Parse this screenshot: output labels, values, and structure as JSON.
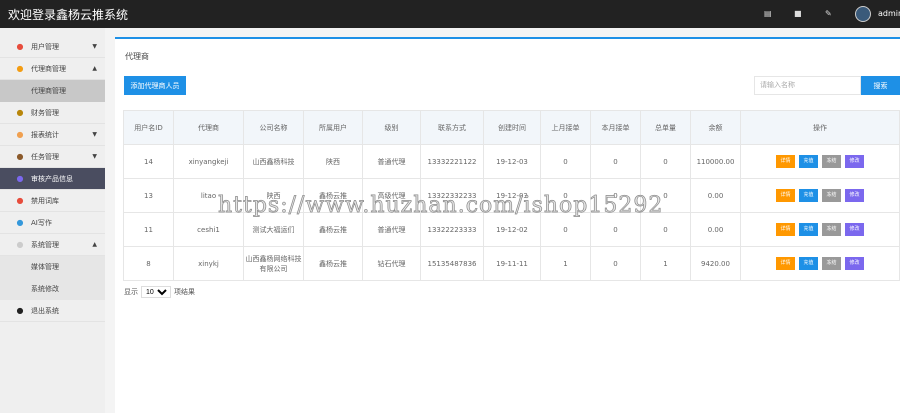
{
  "header": {
    "title": "欢迎登录鑫杨云推系统",
    "user": "admin"
  },
  "sidebar": {
    "items": [
      {
        "label": "用户管理",
        "icon": "user-icon",
        "color": "#e74c3c",
        "arrow": "▼"
      },
      {
        "label": "代理商管理",
        "icon": "user-icon",
        "color": "#f39c12",
        "arrow": "▲"
      },
      {
        "label": "代理商管理",
        "sub": true,
        "selected": true
      },
      {
        "label": "财务管理",
        "icon": "finance-icon",
        "color": "#b8860b"
      },
      {
        "label": "报表统计",
        "icon": "chart-icon",
        "color": "#f0a050",
        "arrow": "▼"
      },
      {
        "label": "任务管理",
        "icon": "task-icon",
        "color": "#8b5a2b",
        "arrow": "▼"
      },
      {
        "label": "审核产品信息",
        "icon": "audit-icon",
        "color": "#7b68ee",
        "active": true
      },
      {
        "label": "禁用词库",
        "icon": "ban-icon",
        "color": "#e74c3c"
      },
      {
        "label": "AI写作",
        "icon": "clipboard-icon",
        "color": "#3498db"
      },
      {
        "label": "系统管理",
        "icon": "play-icon",
        "color": "#ccc",
        "arrow": "▲"
      },
      {
        "label": "媒体管理",
        "sub": true
      },
      {
        "label": "系统修改",
        "sub": true
      },
      {
        "label": "退出系统",
        "icon": "power-icon",
        "color": "#222"
      }
    ]
  },
  "main": {
    "breadcrumb": "代理商",
    "add_label": "添加代理商人员",
    "search_placeholder": "请输入名称",
    "search_label": "搜索",
    "columns": [
      "用户名ID",
      "代理商",
      "公司名称",
      "所属用户",
      "级别",
      "联系方式",
      "创建时间",
      "上月接单",
      "本月接单",
      "总单量",
      "余额",
      "操作"
    ],
    "rows": [
      [
        "14",
        "xinyangkeji",
        "山西鑫杨科技",
        "陕西",
        "普通代理",
        "13332221122",
        "19-12-03",
        "0",
        "0",
        "0",
        "110000.00"
      ],
      [
        "13",
        "litao",
        "陕西",
        "鑫杨云推",
        "高级代理",
        "13322332233",
        "19-12-03",
        "0",
        "0",
        "0",
        "0.00"
      ],
      [
        "11",
        "ceshi1",
        "测试大福运们",
        "鑫杨云推",
        "普通代理",
        "13322223333",
        "19-12-02",
        "0",
        "0",
        "0",
        "0.00"
      ],
      [
        "8",
        "xinykj",
        "山西鑫杨网络科技有限公司",
        "鑫杨云推",
        "钻石代理",
        "15135487836",
        "19-11-11",
        "1",
        "0",
        "1",
        "9420.00"
      ]
    ],
    "actions": [
      {
        "label": "详情",
        "color": "#ff9800"
      },
      {
        "label": "充值",
        "color": "#1e90e6"
      },
      {
        "label": "冻结",
        "color": "#999999"
      },
      {
        "label": "修改",
        "color": "#7b68ee"
      }
    ],
    "page_show": "显示",
    "page_size": "10",
    "page_unit": "项结果"
  },
  "watermark": "https://www.huzhan.com/ishop15292"
}
